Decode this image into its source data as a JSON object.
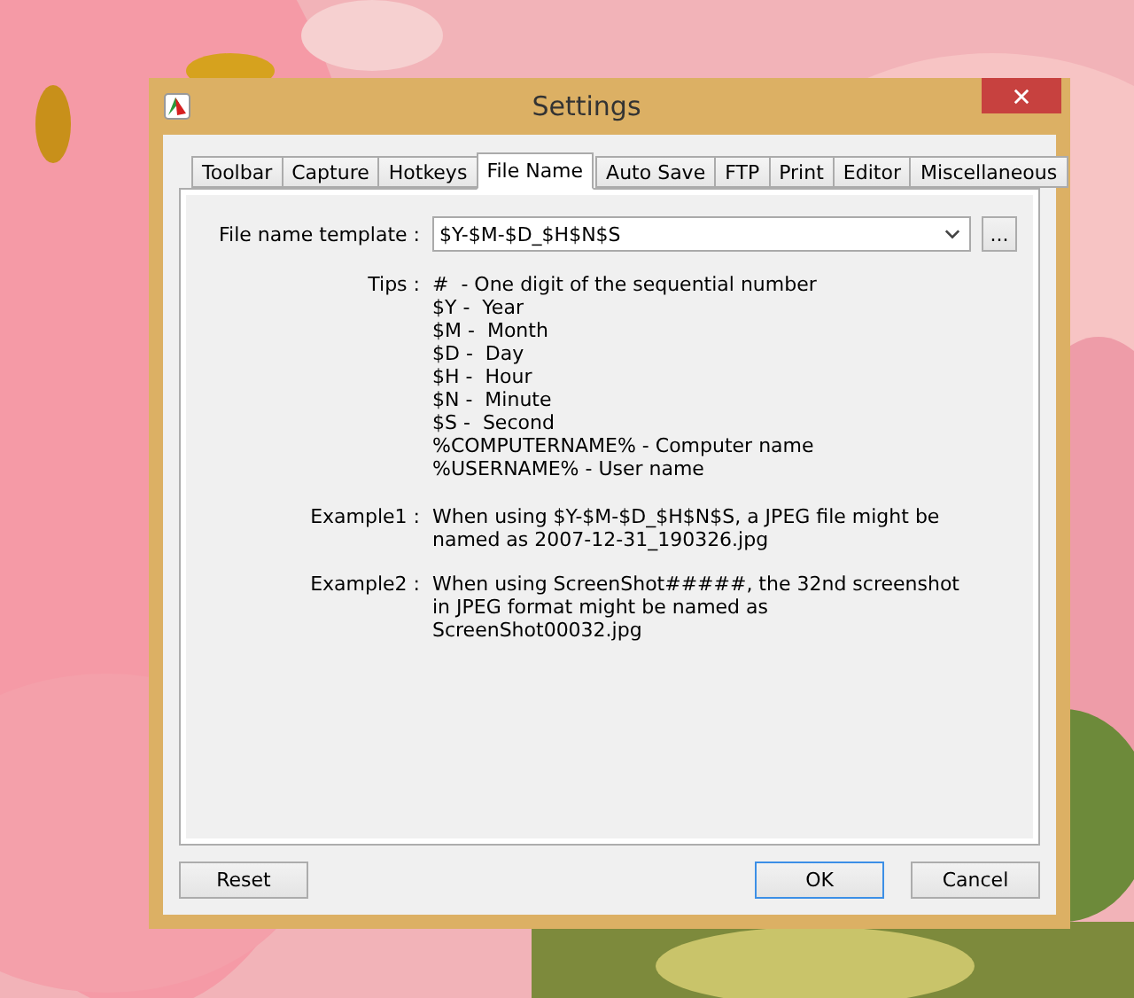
{
  "window": {
    "title": "Settings"
  },
  "tabs": [
    {
      "label": "Toolbar",
      "selected": false
    },
    {
      "label": "Capture",
      "selected": false
    },
    {
      "label": "Hotkeys",
      "selected": false
    },
    {
      "label": "File Name",
      "selected": true
    },
    {
      "label": "Auto Save",
      "selected": false
    },
    {
      "label": "FTP",
      "selected": false
    },
    {
      "label": "Print",
      "selected": false
    },
    {
      "label": "Editor",
      "selected": false
    },
    {
      "label": "Miscellaneous",
      "selected": false
    }
  ],
  "template": {
    "label": "File name template :",
    "value": "$Y-$M-$D_$H$N$S",
    "browse": "..."
  },
  "tips": {
    "label": "Tips :",
    "lines": [
      "#  - One digit of the sequential number",
      "$Y -  Year",
      "$M -  Month",
      "$D -  Day",
      "$H -  Hour",
      "$N -  Minute",
      "$S -  Second",
      "%COMPUTERNAME% - Computer name",
      "%USERNAME% - User name"
    ]
  },
  "examples": [
    {
      "label": "Example1 :",
      "text": "When using $Y-$M-$D_$H$N$S, a JPEG file might be named as 2007-12-31_190326.jpg"
    },
    {
      "label": "Example2 :",
      "text": "When using ScreenShot#####, the 32nd screenshot in JPEG format might be named as ScreenShot00032.jpg"
    }
  ],
  "buttons": [
    {
      "label": "Reset",
      "default": false
    },
    {
      "label": "OK",
      "default": true
    },
    {
      "label": "Cancel",
      "default": false
    }
  ]
}
